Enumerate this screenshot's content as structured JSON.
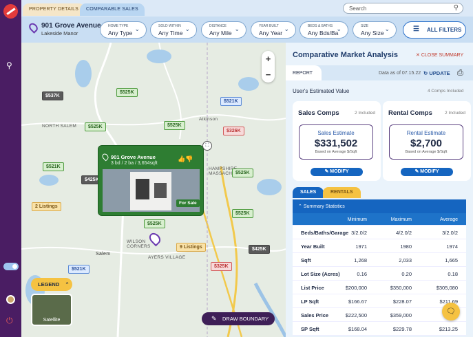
{
  "tabs": [
    "PROPERTY DETAILS",
    "COMPARABLE SALES"
  ],
  "search": {
    "placeholder": "Search"
  },
  "address": {
    "line1": "901 Grove Avenue",
    "line2": "Lakeside Manor"
  },
  "filters": [
    {
      "label": "HOME TYPE",
      "value": "Any Type"
    },
    {
      "label": "SOLD WITHIN",
      "value": "Any Time"
    },
    {
      "label": "DISTANCE",
      "value": "Any Mile"
    },
    {
      "label": "YEAR BUILT",
      "value": "Any Year"
    },
    {
      "label": "BEDS & BATHS",
      "value": "Any Bds/Ba"
    },
    {
      "label": "SIZE",
      "value": "Any Size"
    }
  ],
  "all_filters_label": "ALL FILTERS",
  "map": {
    "labels": [
      "NORTH SALEM",
      "Atkinson",
      "HAMPSHIRE\nMASSACHUSETTS",
      "WILSON\nCORNERS",
      "AYERS VILLAGE",
      "Salem"
    ],
    "pins": [
      {
        "text": "$537K",
        "kind": "k"
      },
      {
        "text": "$525K",
        "kind": "g"
      },
      {
        "text": "$521K",
        "kind": "b"
      },
      {
        "text": "$525K",
        "kind": "g"
      },
      {
        "text": "$525K",
        "kind": "g"
      },
      {
        "text": "$326K",
        "kind": "r"
      },
      {
        "text": "$521K",
        "kind": "g"
      },
      {
        "text": "$425K",
        "kind": "k"
      },
      {
        "text": "$525K",
        "kind": "g"
      },
      {
        "text": "2 Listings",
        "kind": "y"
      },
      {
        "text": "$525K",
        "kind": "g"
      },
      {
        "text": "$525K",
        "kind": "g"
      },
      {
        "text": "9 Listings",
        "kind": "y"
      },
      {
        "text": "$425K",
        "kind": "k"
      },
      {
        "text": "$325K",
        "kind": "r"
      },
      {
        "text": "$521K",
        "kind": "b"
      }
    ],
    "popup": {
      "title": "901 Grove Avenue",
      "details": "3 bd / 2 ba / 3,654sqft",
      "status": "For Sale"
    },
    "legend_label": "LEGEND",
    "satellite_label": "Satellite",
    "draw_label": "DRAW BOUNDARY"
  },
  "panel": {
    "title": "Comparative Market Analysis",
    "close_label": "CLOSE SUMMARY",
    "report_tab": "REPORT",
    "as_of": "Data as of 07.15.22",
    "update_label": "UPDATE",
    "user_value_label": "User's Estimated Value",
    "comps_included": "4 Comps Included",
    "sales_card": {
      "title": "Sales Comps",
      "included": "2 Included",
      "estimate_label": "Sales Estimate",
      "estimate": "$331,502",
      "basis": "Based on Average $/Sqft",
      "button": "MODIFY"
    },
    "rental_card": {
      "title": "Rental Comps",
      "included": "2 Included",
      "estimate_label": "Rental Estimate",
      "estimate": "$2,700",
      "basis": "Based on Average $/Sqft",
      "button": "MODIFY"
    },
    "sub_tabs": [
      "SALES",
      "RENTALS"
    ],
    "summary_label": "Summary Statistics",
    "columns": [
      "",
      "Minimum",
      "Maximum",
      "Average"
    ],
    "rows": [
      [
        "Beds/Baths/Garage",
        "3/2.0/2",
        "4/2.0/2",
        "3/2.0/2"
      ],
      [
        "Year Built",
        "1971",
        "1980",
        "1974"
      ],
      [
        "Sqft",
        "1,268",
        "2,033",
        "1,665"
      ],
      [
        "Lot Size (Acres)",
        "0.16",
        "0.20",
        "0.18"
      ],
      [
        "List Price",
        "$200,000",
        "$350,000",
        "$305,080"
      ],
      [
        "LP Sqft",
        "$166.67",
        "$228.07",
        "$211.69"
      ],
      [
        "Sales Price",
        "$222,500",
        "$359,000",
        "$3"
      ],
      [
        "SP Sqft",
        "$168.04",
        "$229.78",
        "$213.25"
      ]
    ]
  }
}
